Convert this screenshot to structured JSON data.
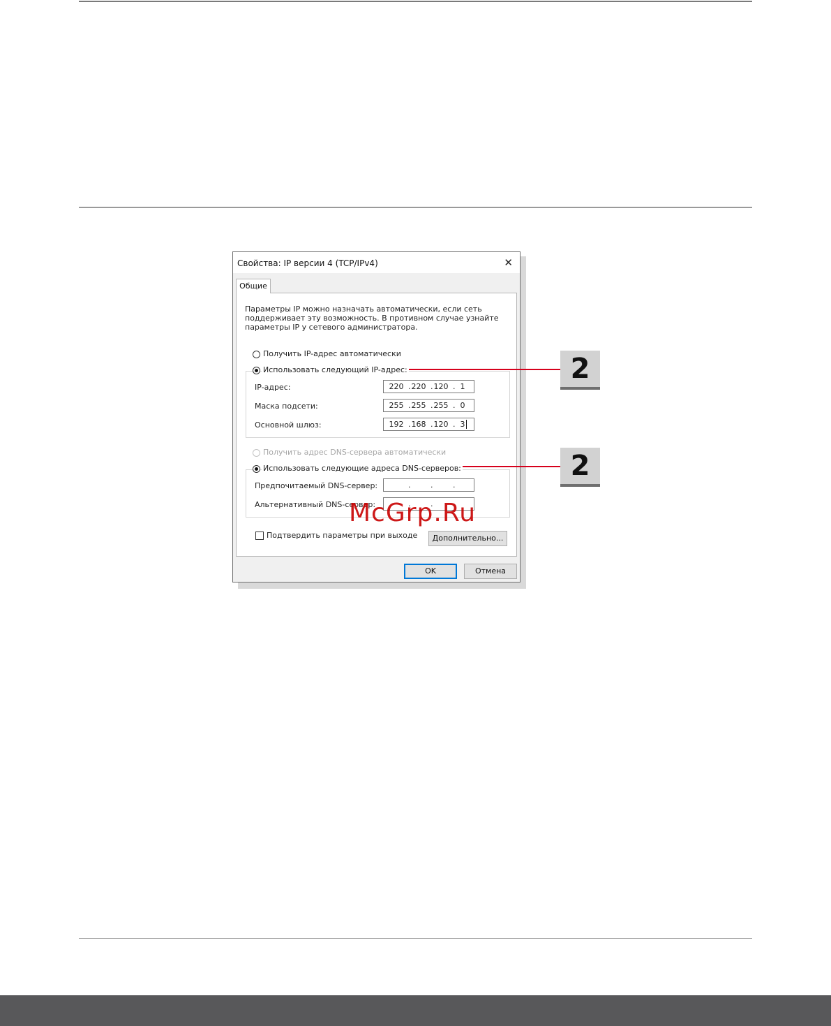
{
  "dialog": {
    "title": "Свойства: IP версии 4 (TCP/IPv4)",
    "close_glyph": "✕",
    "tab_label": "Общие",
    "description": [
      "Параметры IP можно назначать автоматически, если сеть",
      "поддерживает эту возможность. В противном случае узнайте",
      "параметры IP у сетевого администратора."
    ],
    "ip": {
      "auto_label": "Получить IP-адрес автоматически",
      "manual_label": "Использовать следующий IP-адрес:",
      "selected": "manual",
      "fields": [
        {
          "label": "IP-адрес:",
          "octets": [
            "220",
            "220",
            "120",
            "1"
          ]
        },
        {
          "label": "Маска подсети:",
          "octets": [
            "255",
            "255",
            "255",
            "0"
          ]
        },
        {
          "label": "Основной шлюз:",
          "octets": [
            "192",
            "168",
            "120",
            "3"
          ]
        }
      ]
    },
    "dns": {
      "auto_label": "Получить адрес DNS-сервера автоматически",
      "manual_label": "Использовать следующие адреса DNS-серверов:",
      "selected": "manual",
      "fields": [
        {
          "label": "Предпочитаемый DNS-сервер:",
          "octets": [
            "",
            "",
            "",
            ""
          ]
        },
        {
          "label": "Альтернативный DNS-сервер:",
          "octets": [
            "",
            "",
            "",
            ""
          ]
        }
      ]
    },
    "validate_label": "Подтвердить параметры при выходе",
    "validate_checked": false,
    "advanced_button": "Дополнительно...",
    "ok_button": "OK",
    "cancel_button": "Отмена"
  },
  "callouts": [
    {
      "label": "2"
    },
    {
      "label": "2"
    }
  ],
  "watermark": "McGrp.Ru",
  "colors": {
    "callout": "#d6001c",
    "badge": "#d2d2d2",
    "footer_bar": "#58585a",
    "primary_button_border": "#0078d7"
  }
}
